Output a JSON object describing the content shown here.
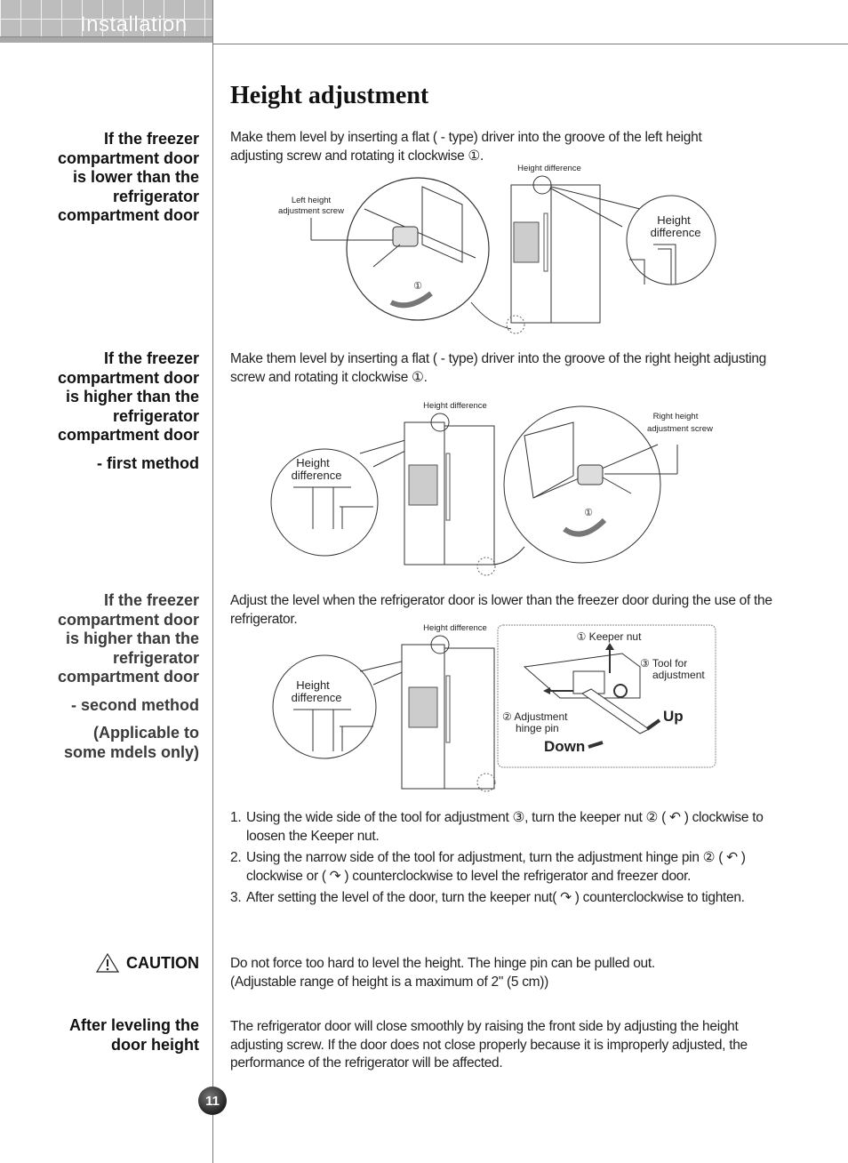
{
  "header": {
    "section_title": "Installation"
  },
  "page_title": "Height adjustment",
  "sections": [
    {
      "side_label": "If the freezer compartment door is lower than the refrigerator compartment door",
      "side_lines": [
        "If the freezer",
        "compartment door",
        "is lower than the",
        "refrigerator",
        "compartment door"
      ],
      "body": "Make them level by inserting a flat ( - type) driver into the groove of the left height adjusting screw and rotating it clockwise ①.",
      "diagram": {
        "labels": {
          "screw": [
            "Left height",
            "adjustment screw"
          ],
          "height_diff_top": "Height difference",
          "height_diff_callout": [
            "Height",
            "difference"
          ],
          "rotation_marker": "①"
        }
      }
    },
    {
      "side_lines": [
        "If the freezer",
        "compartment door",
        "is higher than the",
        "refrigerator",
        "compartment door"
      ],
      "side_sub": "- first method",
      "body": "Make them level by inserting a flat ( - type) driver into the groove of the right height adjusting screw and rotating it clockwise ①.",
      "diagram": {
        "labels": {
          "height_diff_top": "Height difference",
          "height_diff_callout": [
            "Height",
            "difference"
          ],
          "screw": [
            "Right height",
            "adjustment screw"
          ],
          "rotation_marker": "①"
        }
      }
    },
    {
      "side_lines": [
        "If the freezer",
        "compartment door",
        "is higher than the",
        "refrigerator",
        "compartment door"
      ],
      "side_sub": "- second method",
      "side_note": [
        "(Applicable to",
        "some mdels only)"
      ],
      "body": "Adjust the level when the refrigerator door is lower than the freezer door during the use of the refrigerator.",
      "diagram": {
        "labels": {
          "height_diff_top": "Height difference",
          "height_diff_callout": [
            "Height",
            "difference"
          ],
          "keeper_nut": "① Keeper nut",
          "tool": [
            "③ Tool for",
            "adjustment"
          ],
          "hinge_pin": [
            "② Adjustment",
            "hinge pin"
          ],
          "up": "Up",
          "down": "Down"
        }
      },
      "steps": [
        {
          "num": "1.",
          "text": "Using the wide side of the tool for adjustment ③, turn the keeper nut ② ( ↶ ) clockwise to loosen the Keeper nut."
        },
        {
          "num": "2.",
          "text": "Using the narrow side of the tool for adjustment, turn the adjustment hinge pin ② ( ↶ ) clockwise or ( ↷ ) counterclockwise to level the refrigerator and freezer door."
        },
        {
          "num": "3.",
          "text": "After setting the level of the door, turn the keeper nut( ↷ ) counterclockwise to tighten."
        }
      ]
    }
  ],
  "caution": {
    "label": "CAUTION",
    "icon": "warning-triangle-icon",
    "text_lines": [
      "Do not force too hard to level the height. The hinge pin can be pulled out.",
      "(Adjustable range of height is a maximum of 2\" (5 cm))"
    ]
  },
  "after": {
    "side_lines": [
      "After leveling the",
      "door height"
    ],
    "body": "The refrigerator door will close smoothly by raising the front side by adjusting the height adjusting screw. If the door does not close properly because it is improperly adjusted, the performance of the refrigerator will be affected."
  },
  "page_number": "11"
}
